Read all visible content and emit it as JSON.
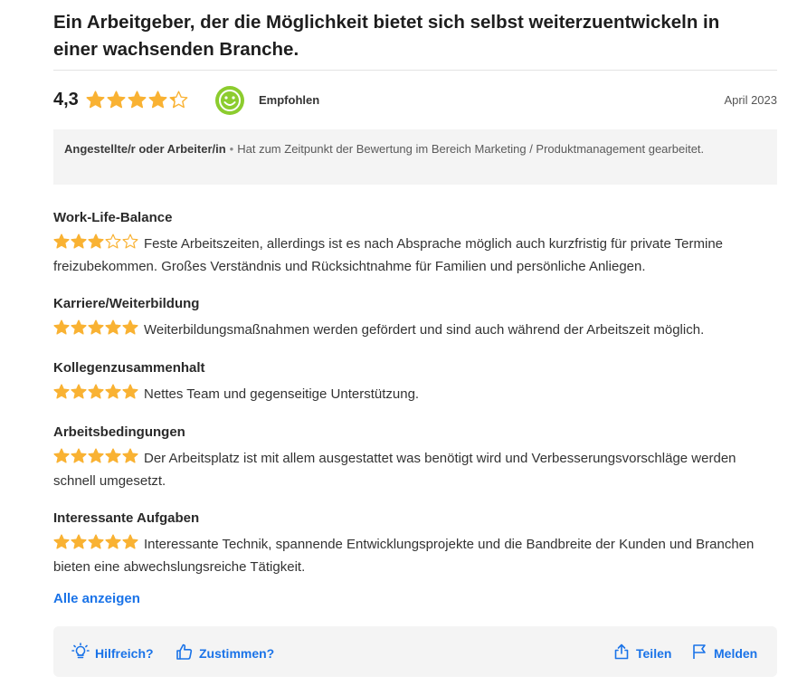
{
  "review": {
    "title": "Ein Arbeitgeber, der die Möglichkeit bietet sich selbst weiterzuentwickeln in einer wachsenden Branche.",
    "score": "4,3",
    "score_value": 4.3,
    "recommended_label": "Empfohlen",
    "date": "April 2023"
  },
  "author": {
    "role": "Angestellte/r oder Arbeiter/in",
    "bullet": "•",
    "details": "Hat zum Zeitpunkt der Bewertung im Bereich Marketing / Produktmanagement gearbeitet."
  },
  "sections": [
    {
      "title": "Work-Life-Balance",
      "stars": 3,
      "text": "Feste Arbeitszeiten, allerdings ist es nach Absprache möglich auch kurzfristig für private Termine freizubekommen. Großes Verständnis und Rücksichtnahme für Familien und persönliche Anliegen."
    },
    {
      "title": "Karriere/Weiterbildung",
      "stars": 5,
      "text": "Weiterbildungsmaßnahmen werden gefördert und sind auch während der Arbeitszeit möglich."
    },
    {
      "title": "Kollegenzusammenhalt",
      "stars": 5,
      "text": "Nettes Team und gegenseitige Unterstützung."
    },
    {
      "title": "Arbeitsbedingungen",
      "stars": 5,
      "text": "Der Arbeitsplatz ist mit allem ausgestattet was benötigt wird und Verbesserungsvorschläge werden schnell umgesetzt."
    },
    {
      "title": "Interessante Aufgaben",
      "stars": 5,
      "text": "Interessante Technik, spannende Entwicklungsprojekte und die Bandbreite der Kunden und Branchen bieten eine abwechslungsreiche Tätigkeit."
    }
  ],
  "show_all_label": "Alle anzeigen",
  "actions": {
    "helpful": "Hilfreich?",
    "agree": "Zustimmen?",
    "share": "Teilen",
    "report": "Melden"
  },
  "colors": {
    "star": "#f9b233",
    "star_empty": "#f9b233",
    "accent": "#1a73e8",
    "smile": "#8ccc2e"
  },
  "icons": {
    "rating": "star-icon",
    "recommended": "smiley-icon",
    "helpful": "lightbulb-icon",
    "agree": "thumbs-up-icon",
    "share": "share-icon",
    "report": "flag-icon"
  }
}
